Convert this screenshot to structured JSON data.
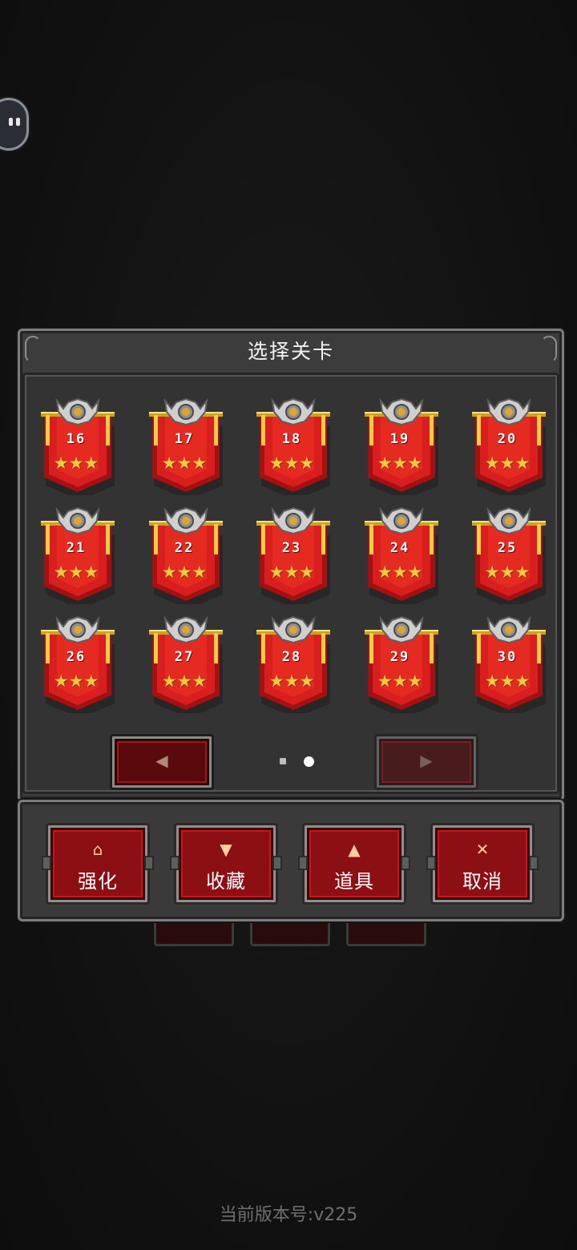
{
  "dialog": {
    "title": "选择关卡",
    "levels": [
      {
        "number": "16",
        "stars": 3
      },
      {
        "number": "17",
        "stars": 3
      },
      {
        "number": "18",
        "stars": 3
      },
      {
        "number": "19",
        "stars": 3
      },
      {
        "number": "20",
        "stars": 3
      },
      {
        "number": "21",
        "stars": 3
      },
      {
        "number": "22",
        "stars": 3
      },
      {
        "number": "23",
        "stars": 3
      },
      {
        "number": "24",
        "stars": 3
      },
      {
        "number": "25",
        "stars": 3
      },
      {
        "number": "26",
        "stars": 3
      },
      {
        "number": "27",
        "stars": 3
      },
      {
        "number": "28",
        "stars": 3
      },
      {
        "number": "29",
        "stars": 3
      },
      {
        "number": "30",
        "stars": 3
      }
    ],
    "pager": {
      "prev_icon": "◀",
      "next_icon": "▶",
      "total_pages": 2,
      "current_page": 2
    }
  },
  "actions": [
    {
      "label": "强化",
      "icon": "upgrade-icon",
      "glyph": "⌂"
    },
    {
      "label": "收藏",
      "icon": "goblet-icon",
      "glyph": "▼"
    },
    {
      "label": "道具",
      "icon": "potion-icon",
      "glyph": "▲"
    },
    {
      "label": "取消",
      "icon": "close-icon",
      "glyph": "✕"
    }
  ],
  "version_text": "当前版本号:v225",
  "colors": {
    "banner_red": "#d81e1e",
    "banner_dark": "#a01212",
    "star_gold": "#f5c842",
    "button_red": "#8c0f14"
  }
}
